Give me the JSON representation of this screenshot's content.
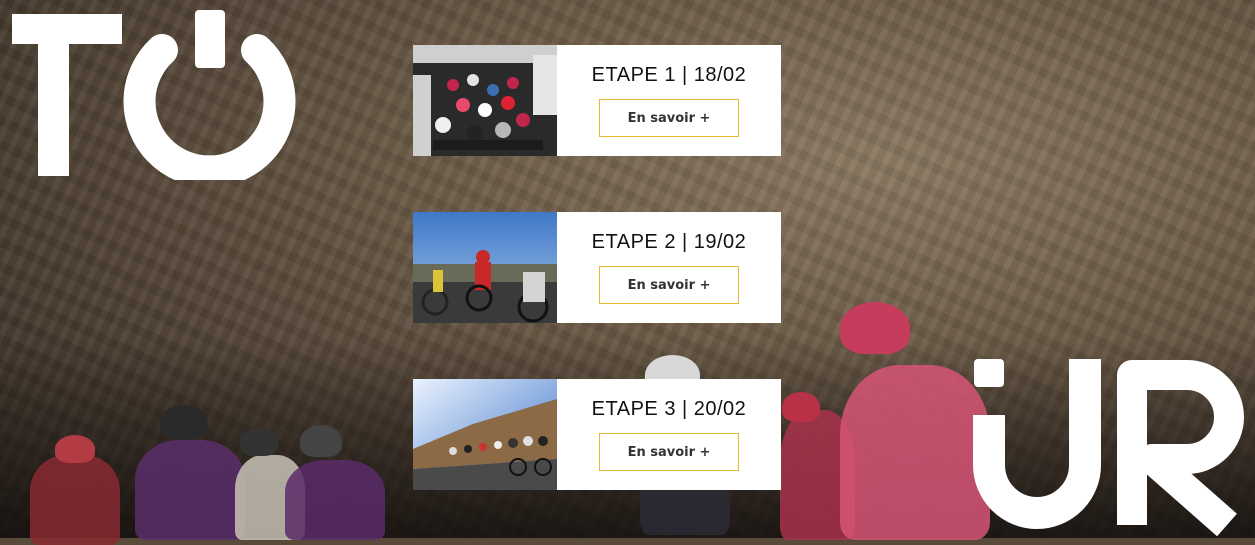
{
  "brand": {
    "letters_left": "TO",
    "letters_right": "UR"
  },
  "stages": [
    {
      "title": "ETAPE 1 | 18/02",
      "button": "En savoir +",
      "thumb": "peloton-crowd-photo"
    },
    {
      "title": "ETAPE 2 | 19/02",
      "button": "En savoir +",
      "thumb": "riders-blue-sky-photo"
    },
    {
      "title": "ETAPE 3 | 20/02",
      "button": "En savoir +",
      "thumb": "mountain-road-photo"
    }
  ],
  "colors": {
    "accent": "#e7b92a",
    "card_bg": "#ffffff"
  }
}
